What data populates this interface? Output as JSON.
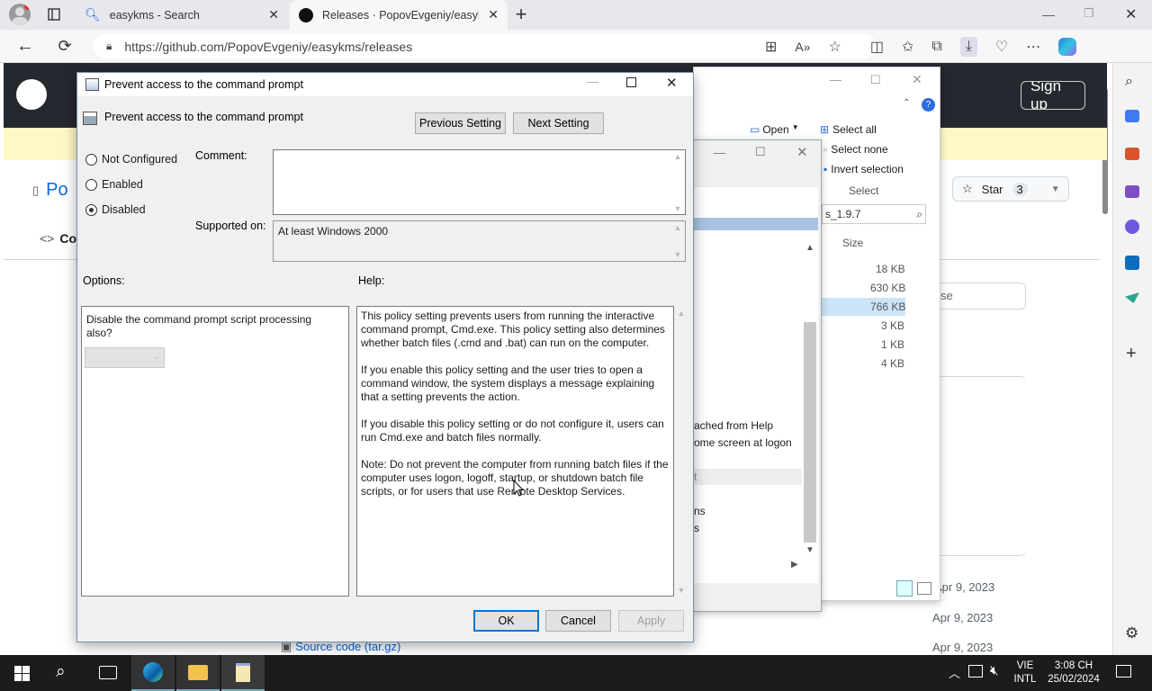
{
  "browser": {
    "tabs": [
      {
        "title": "easykms - Search",
        "active": false
      },
      {
        "title": "Releases · PopovEvgeniy/easykm",
        "active": true
      }
    ],
    "url": "https://github.com/PopovEvgeniy/easykms/releases"
  },
  "github": {
    "repo_short": "Po",
    "code_tab": "Co",
    "sign_up": "Sign up",
    "star_label": "Star",
    "star_count": "3",
    "search_placeholder": "se",
    "dates": [
      "Apr 9, 2023",
      "Apr 9, 2023",
      "Apr 9, 2023"
    ],
    "source_code": "Source code (tar.gz)"
  },
  "explorer": {
    "ribbon": {
      "open": "Open",
      "select_all": "Select all",
      "select_none": "Select none",
      "invert_selection": "Invert selection",
      "select_group": "Select"
    },
    "search_value": "s_1.9.7",
    "size_header": "Size",
    "sizes": [
      "18 KB",
      "630 KB",
      "766 KB",
      "3 KB",
      "1 KB",
      "4 KB"
    ],
    "snippets": [
      "ached from Help",
      "ome screen at logon",
      "t",
      "ns",
      "s",
      ".."
    ]
  },
  "dialog": {
    "window_title": "Prevent access to the command prompt",
    "policy_name": "Prevent access to the command prompt",
    "prev_button": "Previous Setting",
    "next_button": "Next Setting",
    "radio_not_configured": "Not Configured",
    "radio_enabled": "Enabled",
    "radio_disabled": "Disabled",
    "selected_state": "Disabled",
    "comment_label": "Comment:",
    "comment_value": "",
    "supported_label": "Supported on:",
    "supported_value": "At least Windows 2000",
    "options_label": "Options:",
    "help_label": "Help:",
    "option_question": "Disable the command prompt script processing also?",
    "help_paragraphs": [
      "This policy setting prevents users from running the interactive command prompt, Cmd.exe.  This policy setting also determines whether batch files (.cmd and .bat) can run on the computer.",
      "If you enable this policy setting and the user tries to open a command window, the system displays a message explaining that a setting prevents the action.",
      "If you disable this policy setting or do not configure it, users can run Cmd.exe and batch files normally.",
      "Note: Do not prevent the computer from running batch files if the computer uses logon, logoff, startup, or shutdown batch file scripts, or for users that use Remote Desktop Services."
    ],
    "ok_button": "OK",
    "cancel_button": "Cancel",
    "apply_button": "Apply"
  },
  "taskbar": {
    "lang_top": "VIE",
    "lang_bottom": "INTL",
    "time": "3:08 CH",
    "date": "25/02/2024"
  },
  "colors": {
    "accent": "#0078d7",
    "github_dark": "#24292f",
    "taskbar": "#1c1c1c"
  }
}
